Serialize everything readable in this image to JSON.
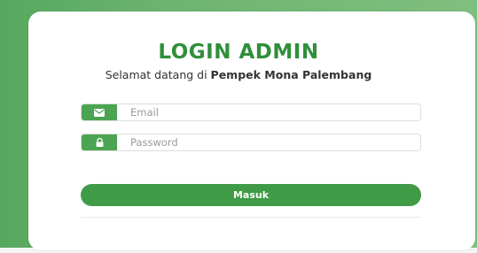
{
  "login": {
    "title": "LOGIN ADMIN",
    "subtitle_prefix": "Selamat datang di ",
    "subtitle_brand": "Pempek Mona Palembang",
    "email": {
      "icon": "envelope-icon",
      "placeholder": "Email",
      "value": ""
    },
    "password": {
      "icon": "lock-icon",
      "placeholder": "Password",
      "value": ""
    },
    "submit_label": "Masuk"
  },
  "colors": {
    "accent": "#3f9b46",
    "title": "#2f8f3a",
    "background_gradient_start": "#57a85e",
    "background_gradient_end": "#7fbf7f"
  }
}
